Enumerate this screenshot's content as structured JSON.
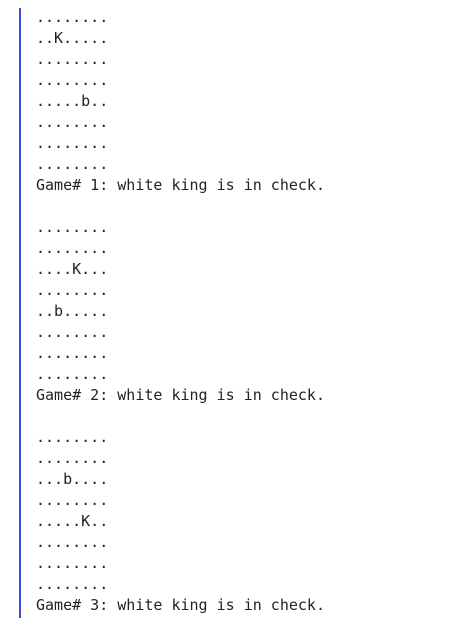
{
  "games": [
    {
      "board": [
        "........",
        "..K.....",
        "........",
        "........",
        ".....b..",
        "........",
        "........",
        "........"
      ],
      "result": "Game# 1: white king is in check."
    },
    {
      "board": [
        "........",
        "........",
        "....K...",
        "........",
        "..b.....",
        "........",
        "........",
        "........"
      ],
      "result": "Game# 2: white king is in check."
    },
    {
      "board": [
        "........",
        "........",
        "...b....",
        "........",
        ".....K..",
        "........",
        "........",
        "........"
      ],
      "result": "Game# 3: white king is in check."
    }
  ]
}
